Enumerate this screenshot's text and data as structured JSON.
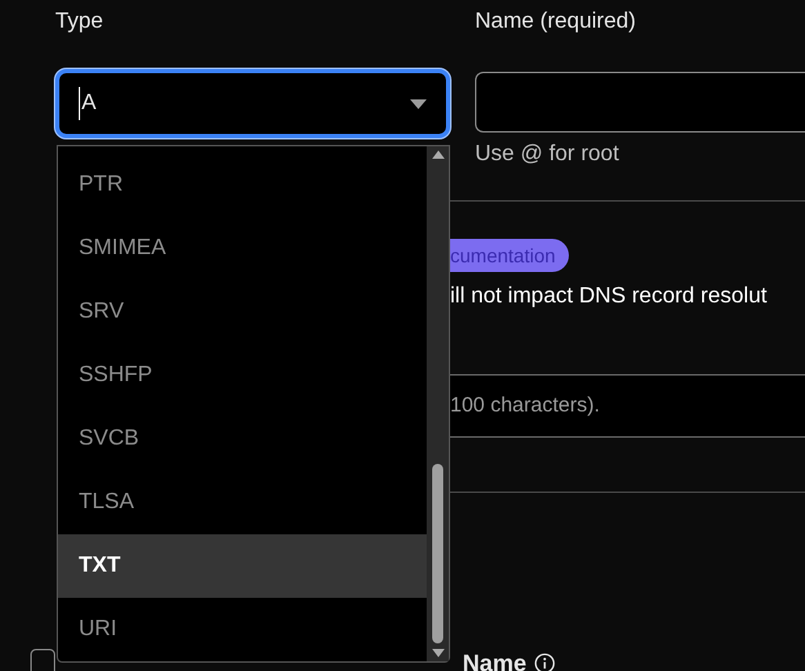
{
  "type_field": {
    "label": "Type",
    "value": "A",
    "focused": true,
    "options": [
      {
        "label": "PTR",
        "selected": false
      },
      {
        "label": "SMIMEA",
        "selected": false
      },
      {
        "label": "SRV",
        "selected": false
      },
      {
        "label": "SSHFP",
        "selected": false
      },
      {
        "label": "SVCB",
        "selected": false
      },
      {
        "label": "TLSA",
        "selected": false
      },
      {
        "label": "TXT",
        "selected": true
      },
      {
        "label": "URI",
        "selected": false
      }
    ]
  },
  "name_field": {
    "label": "Name (required)",
    "hint": "Use @ for root"
  },
  "documentation_badge": "cumentation",
  "note": "ill not impact DNS record resolut",
  "comment_field": {
    "placeholder": "100 characters)."
  },
  "table_header": {
    "select_all_checked": false,
    "columns": [
      {
        "label": "Name"
      }
    ]
  }
}
